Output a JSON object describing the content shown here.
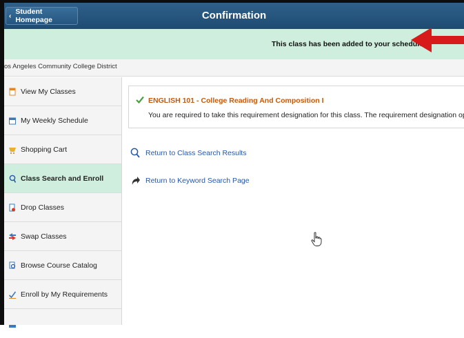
{
  "header": {
    "home_button": "Student Homepage",
    "title": "Confirmation"
  },
  "banner": {
    "message": "This class has been added to your schedule."
  },
  "district": "os Angeles Community College District",
  "sidebar": {
    "items": [
      {
        "label": "View My Classes",
        "icon": "class-list-icon"
      },
      {
        "label": "My Weekly Schedule",
        "icon": "calendar-icon"
      },
      {
        "label": "Shopping Cart",
        "icon": "shopping-cart-icon"
      },
      {
        "label": "Class Search and Enroll",
        "icon": "search-icon",
        "active": true
      },
      {
        "label": "Drop Classes",
        "icon": "drop-icon"
      },
      {
        "label": "Swap Classes",
        "icon": "swap-icon"
      },
      {
        "label": "Browse Course Catalog",
        "icon": "catalog-icon"
      },
      {
        "label": "Enroll by My Requirements",
        "icon": "checkmark-icon"
      }
    ]
  },
  "confirmation": {
    "course": "ENGLISH 101 - College Reading And Composition I",
    "note": "You are required to take this requirement designation for this class. The requirement designation option has been se"
  },
  "links": {
    "class_search": "Return to Class Search Results",
    "keyword_search": "Return to Keyword Search Page"
  },
  "colors": {
    "header": "#24557f",
    "banner": "#cfeedd",
    "course_title": "#c35a0c",
    "link": "#2456a8",
    "arrow": "#d71a1a"
  }
}
